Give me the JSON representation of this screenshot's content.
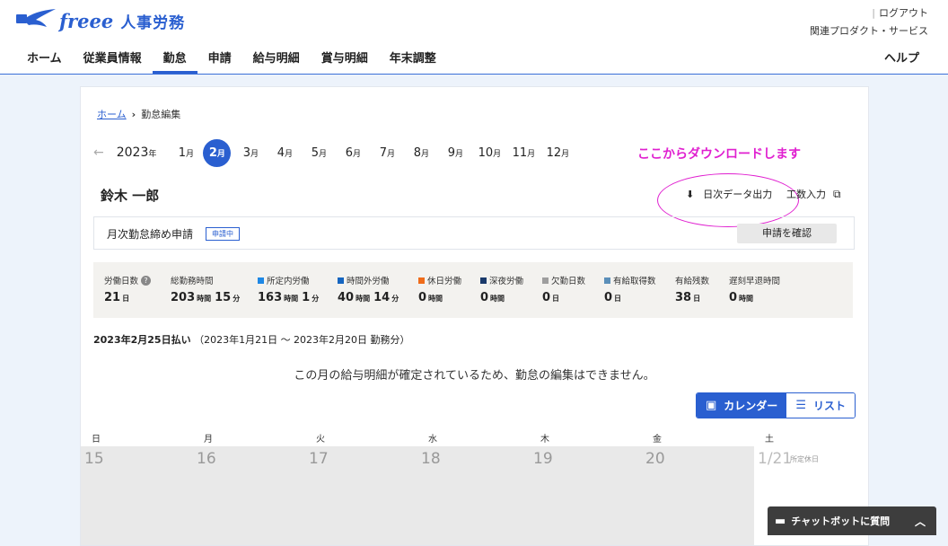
{
  "header": {
    "brand": "freee",
    "product": "人事労務",
    "logout": "ログアウト",
    "related": "関連プロダクト・サービス",
    "help": "ヘルプ",
    "nav": [
      "ホーム",
      "従業員情報",
      "勤怠",
      "申請",
      "給与明細",
      "賞与明細",
      "年末調整"
    ],
    "active_nav": "勤怠"
  },
  "breadcrumb": {
    "home": "ホーム",
    "current": "勤怠編集"
  },
  "months": {
    "year": "2023",
    "year_suffix": "年",
    "items": [
      "1",
      "2",
      "3",
      "4",
      "5",
      "6",
      "7",
      "8",
      "9",
      "10",
      "11",
      "12"
    ],
    "suffix": "月",
    "active": "2"
  },
  "annotation": "ここからダウンロードします",
  "employee_name": "鈴木 一郎",
  "actions": {
    "daily_export": "日次データ出力",
    "kosu": "工数入力"
  },
  "request": {
    "title": "月次勤怠締め申請",
    "status": "申請中",
    "confirm": "申請を確認"
  },
  "stats": [
    {
      "label": "労働日数",
      "value": "21",
      "unit": "日",
      "help": true
    },
    {
      "label": "総勤務時間",
      "value": "203",
      "unit": "時間",
      "value2": "15",
      "unit2": "分"
    },
    {
      "label": "所定内労働",
      "color": "#1e88e5",
      "value": "163",
      "unit": "時間",
      "value2": "1",
      "unit2": "分"
    },
    {
      "label": "時間外労働",
      "color": "#1565c0",
      "value": "40",
      "unit": "時間",
      "value2": "14",
      "unit2": "分"
    },
    {
      "label": "休日労働",
      "color": "#ef6c1a",
      "value": "0",
      "unit": "時間"
    },
    {
      "label": "深夜労働",
      "color": "#1a3a6b",
      "value": "0",
      "unit": "時間"
    },
    {
      "label": "欠勤日数",
      "color": "#9e9e9e",
      "value": "0",
      "unit": "日"
    },
    {
      "label": "有給取得数",
      "color": "#5b8fb9",
      "value": "0",
      "unit": "日"
    },
    {
      "label": "有給残数",
      "value": "38",
      "unit": "日"
    },
    {
      "label": "遅刻早退時間",
      "value": "0",
      "unit": "時間"
    }
  ],
  "pay": {
    "date": "2023年2月25日払い",
    "period": "（2023年1月21日 〜 2023年2月20日 勤務分）"
  },
  "notice": "この月の給与明細が確定されているため、勤怠の編集はできません。",
  "view_toggle": {
    "calendar": "カレンダー",
    "list": "リスト"
  },
  "weekdays": [
    "日",
    "月",
    "火",
    "水",
    "木",
    "金",
    "土"
  ],
  "calendar_days": [
    "15",
    "16",
    "17",
    "18",
    "19",
    "20",
    "1/21"
  ],
  "saturday_label": "所定休日",
  "chat": "チャットボットに質問"
}
